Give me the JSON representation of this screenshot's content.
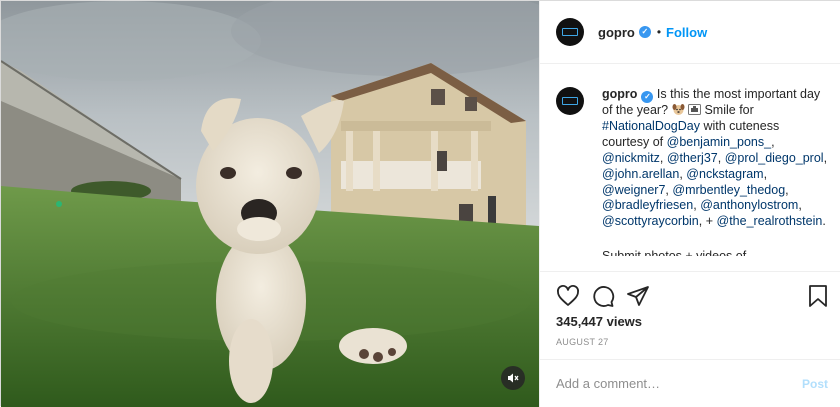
{
  "account": {
    "username": "gopro",
    "verified": true,
    "verified_icon": "verified-badge-icon",
    "dot": "•",
    "follow_label": "Follow"
  },
  "caption": {
    "username": "gopro",
    "parts": {
      "p1": "Is this the most important day of the year?",
      "p2": "Smile for",
      "hashtag": "#NationalDogDay",
      "p3": "with cuteness courtesy of",
      "mentions": [
        "@benjamin_pons_",
        "@nickmitz",
        "@therj37",
        "@prol_diego_prol",
        "@john.arellan",
        "@nckstagram",
        "@weigner7",
        "@mrbentley_thedog",
        "@bradleyfriesen",
        "@anthonylostrom",
        "@scottyraycorbin",
        "@the_realrothstein"
      ],
      "sep": ",",
      "plus": "+",
      "period": "."
    },
    "emojis": [
      "dog-face-emoji",
      "camera-emoji"
    ],
    "more_text": "Submit photos + videos of"
  },
  "actions": {
    "icons": [
      "heart-icon",
      "comment-icon",
      "share-icon",
      "bookmark-icon"
    ]
  },
  "stats": {
    "views": "345,447 views",
    "date": "AUGUST 27"
  },
  "comment": {
    "placeholder": "Add a comment…",
    "post_label": "Post"
  },
  "media": {
    "description_icon": "mute-icon"
  },
  "colors": {
    "accent": "#0095f6",
    "link": "#00376b",
    "muted": "#8e8e8e",
    "post_disabled": "#b2dffc",
    "verified": "#3897f0"
  }
}
